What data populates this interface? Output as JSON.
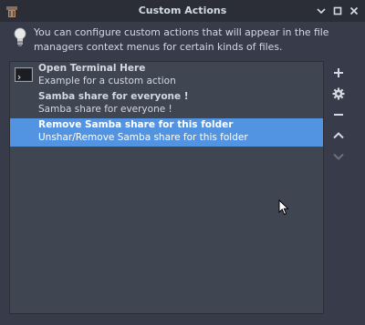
{
  "window": {
    "title": "Custom Actions"
  },
  "info": {
    "text": "You can configure custom actions that will appear in the file managers context menus for certain kinds of files."
  },
  "actions": [
    {
      "name": "Open Terminal Here",
      "description": "Example for a custom action",
      "icon": "terminal-icon",
      "selected": false
    },
    {
      "name": "Samba share for everyone !",
      "description": "Samba share for everyone !",
      "icon": "",
      "selected": false
    },
    {
      "name": "Remove Samba share for this folder",
      "description": "Unshar/Remove Samba share for this folder",
      "icon": "",
      "selected": true
    }
  ],
  "side_buttons": [
    {
      "name": "add-icon",
      "enabled": true
    },
    {
      "name": "gear-icon",
      "enabled": true
    },
    {
      "name": "remove-icon",
      "enabled": true
    },
    {
      "name": "chevron-up-icon",
      "enabled": true
    },
    {
      "name": "chevron-down-icon",
      "enabled": false
    }
  ],
  "colors": {
    "background": "#383c4a",
    "titlebar": "#2b2e37",
    "list_background": "#404552",
    "selection": "#5294e2",
    "text": "#d3dae3"
  }
}
